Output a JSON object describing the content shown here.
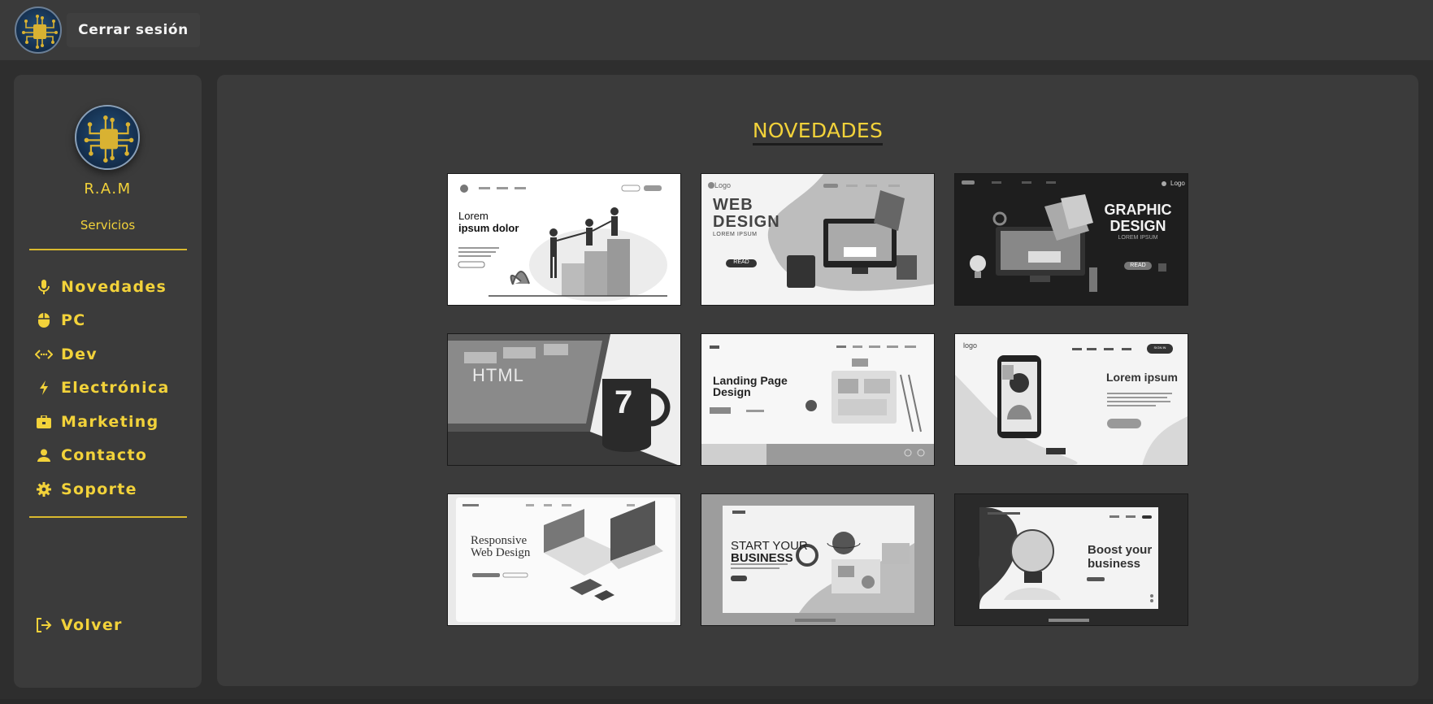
{
  "topbar": {
    "logout_label": "Cerrar sesión"
  },
  "sidebar": {
    "brand": "R.A.M",
    "services_label": "Servicios",
    "items": [
      {
        "label": "Novedades",
        "icon": "microphone-icon"
      },
      {
        "label": "PC",
        "icon": "mouse-icon"
      },
      {
        "label": "Dev",
        "icon": "code-icon"
      },
      {
        "label": "Electrónica",
        "icon": "bolt-icon"
      },
      {
        "label": "Marketing",
        "icon": "briefcase-icon"
      },
      {
        "label": "Contacto",
        "icon": "user-icon"
      },
      {
        "label": "Soporte",
        "icon": "gear-icon"
      }
    ],
    "back_label": "Volver"
  },
  "main": {
    "title": "NOVEDADES",
    "cards": [
      {
        "lines": [
          "Lorem",
          "ipsum dolor"
        ]
      },
      {
        "logo": "Logo",
        "lines": [
          "WEB",
          "DESIGN",
          "LOREM IPSUM"
        ],
        "button": "READ"
      },
      {
        "logo": "Logo",
        "lines": [
          "GRAPHIC",
          "DESIGN",
          "LOREM IPSUM"
        ],
        "button": "READ"
      },
      {
        "lines": [
          "HTML",
          "7"
        ]
      },
      {
        "lines": [
          "Landing Page",
          "Design"
        ]
      },
      {
        "logo": "logo",
        "lines": [
          "Lorem ipsum"
        ],
        "nav": [
          "HOME",
          "NEWS",
          "ABOUT",
          "INFO"
        ],
        "button": "SIGN IN"
      },
      {
        "lines": [
          "Responsive",
          "Web Design"
        ]
      },
      {
        "lines": [
          "START YOUR",
          "BUSINESS"
        ]
      },
      {
        "lines": [
          "Boost your",
          "business"
        ]
      }
    ]
  },
  "colors": {
    "accent": "#f2d23a",
    "panel": "#3b3b3b",
    "background": "#2e2e2e"
  }
}
